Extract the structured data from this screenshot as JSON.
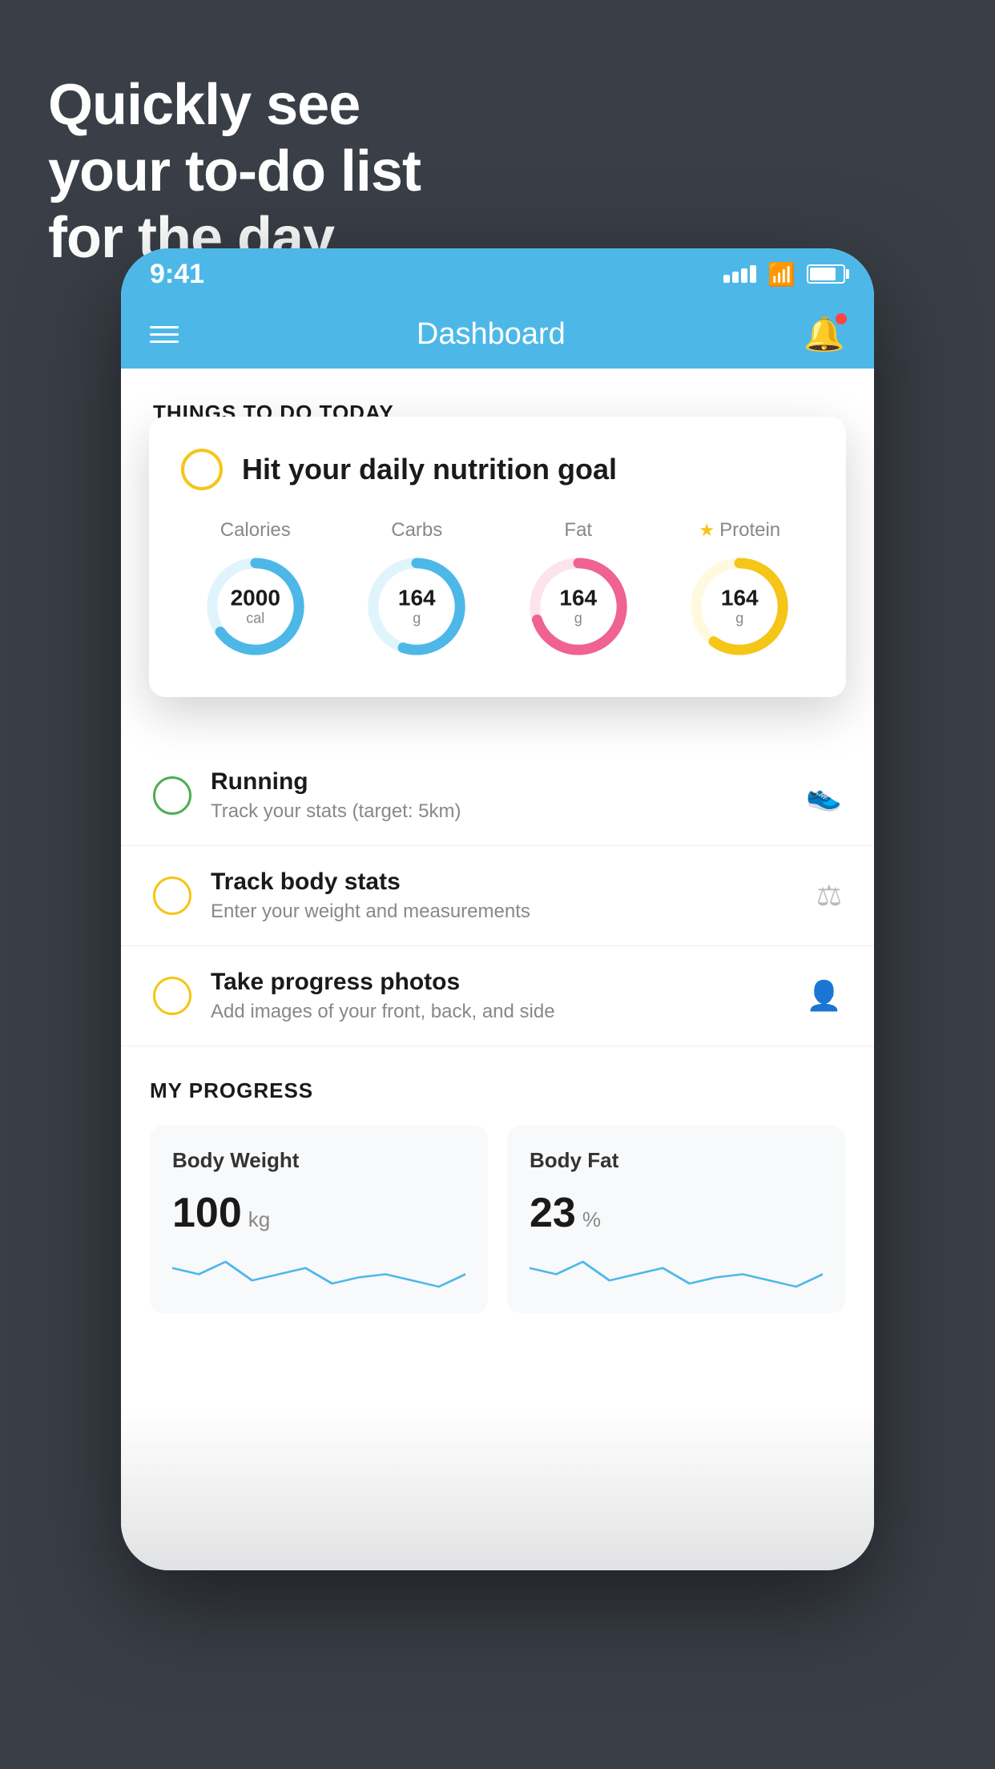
{
  "hero": {
    "title_line1": "Quickly see",
    "title_line2": "your to-do list",
    "title_line3": "for the day."
  },
  "status_bar": {
    "time": "9:41",
    "signal_alt": "signal bars",
    "wifi_alt": "wifi",
    "battery_alt": "battery"
  },
  "header": {
    "title": "Dashboard"
  },
  "things_section": {
    "title": "THINGS TO DO TODAY"
  },
  "floating_card": {
    "title": "Hit your daily nutrition goal",
    "metrics": [
      {
        "label": "Calories",
        "value": "2000",
        "unit": "cal",
        "color": "#4db8e8",
        "track_color": "#e0f4fc",
        "pct": 65,
        "starred": false
      },
      {
        "label": "Carbs",
        "value": "164",
        "unit": "g",
        "color": "#4db8e8",
        "track_color": "#e0f4fc",
        "pct": 55,
        "starred": false
      },
      {
        "label": "Fat",
        "value": "164",
        "unit": "g",
        "color": "#f06292",
        "track_color": "#fce4ec",
        "pct": 70,
        "starred": false
      },
      {
        "label": "Protein",
        "value": "164",
        "unit": "g",
        "color": "#f5c518",
        "track_color": "#fff9e0",
        "pct": 60,
        "starred": true
      }
    ]
  },
  "todo_items": [
    {
      "name": "Running",
      "sub": "Track your stats (target: 5km)",
      "circle_color": "green",
      "icon": "👟"
    },
    {
      "name": "Track body stats",
      "sub": "Enter your weight and measurements",
      "circle_color": "yellow",
      "icon": "⚖"
    },
    {
      "name": "Take progress photos",
      "sub": "Add images of your front, back, and side",
      "circle_color": "yellow",
      "icon": "👤"
    }
  ],
  "progress_section": {
    "title": "MY PROGRESS",
    "cards": [
      {
        "title": "Body Weight",
        "value": "100",
        "unit": "kg",
        "sparkline": [
          40,
          38,
          42,
          36,
          38,
          40,
          35,
          37,
          38,
          36,
          34,
          38
        ]
      },
      {
        "title": "Body Fat",
        "value": "23",
        "unit": "%",
        "sparkline": [
          30,
          28,
          32,
          26,
          28,
          30,
          25,
          27,
          28,
          26,
          24,
          28
        ]
      }
    ]
  }
}
